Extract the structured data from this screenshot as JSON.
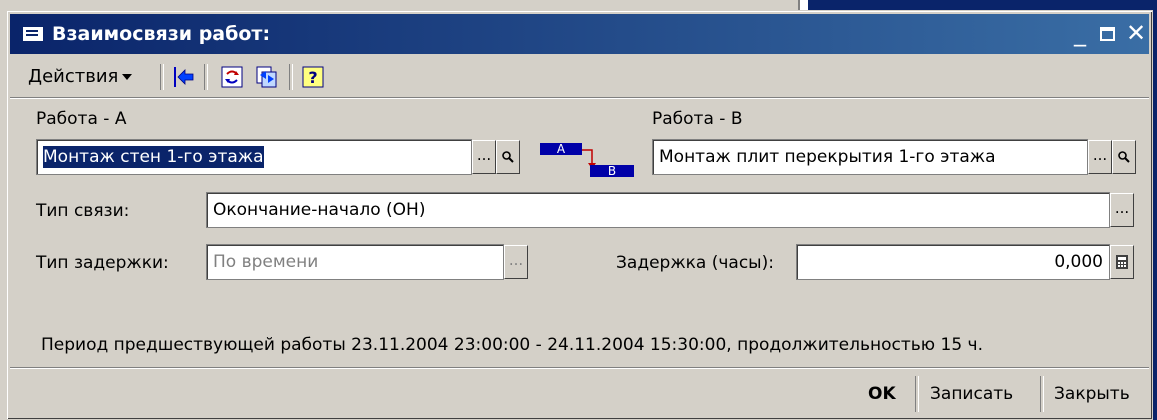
{
  "window": {
    "title": "Взаимосвязи работ:",
    "controls": {
      "minimize": "_",
      "close": "✕"
    }
  },
  "toolbar": {
    "actions_label": "Действия",
    "icons": [
      "arrow-left-blue-icon",
      "refresh-icon",
      "swap-icon",
      "help-icon"
    ],
    "help_glyph": "?"
  },
  "form": {
    "work_a": {
      "label": "Работа - А",
      "value": "Монтаж стен 1-го этажа"
    },
    "work_b": {
      "label": "Работа - В",
      "value": "Монтаж плит перекрытия 1-го этажа"
    },
    "link_diagram": {
      "a": "А",
      "b": "В"
    },
    "link_type": {
      "label": "Тип связи:",
      "value": "Окончание-начало (ОН)"
    },
    "delay_type": {
      "label": "Тип задержки:",
      "value": "По времени"
    },
    "delay_hours": {
      "label": "Задержка (часы):",
      "value": "0,000"
    },
    "select_glyph": "...",
    "period_text": "Период предшествующей работы 23.11.2004 23:00:00 - 24.11.2004 15:30:00, продолжительностью 15 ч."
  },
  "footer": {
    "ok": "OK",
    "save": "Записать",
    "close": "Закрыть"
  },
  "colors": {
    "titlebar": "#0a246a",
    "face": "#d4d0c8",
    "selection": "#0a246a"
  }
}
